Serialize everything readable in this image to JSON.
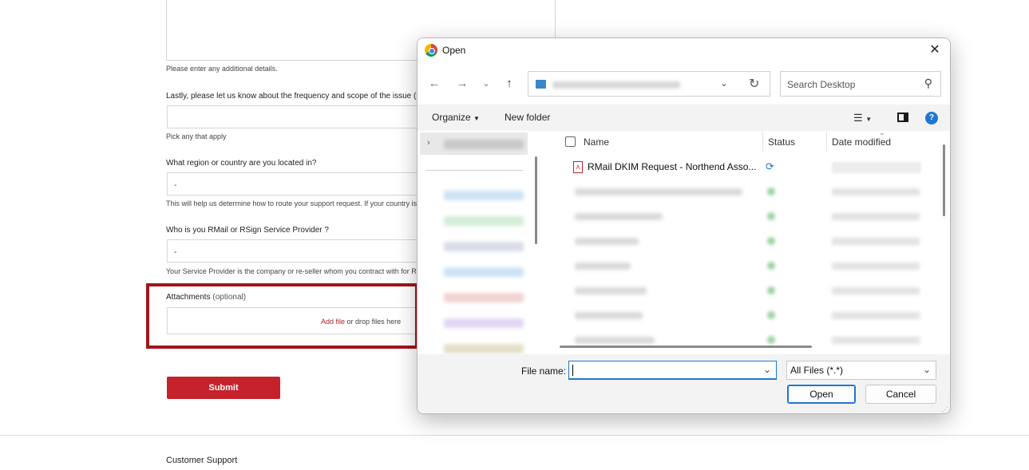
{
  "form": {
    "details_help": "Please enter any additional details.",
    "frequency_question": "Lastly, please let us know about the frequency and scope of the issue (op",
    "frequency_help": "Pick any that apply",
    "region_question": "What region or country are you located in?",
    "region_value": "-",
    "region_help": "This will help us determine how to route your support request. If your country is",
    "provider_question": "Who is you RMail or RSign Service Provider ?",
    "provider_value": "-",
    "provider_help": "Your Service Provider is the company or re-seller whom you contract with for R",
    "attachments_label": "Attachments",
    "attachments_optional": "(optional)",
    "add_file": "Add file",
    "drop_text": "or drop files here",
    "submit_label": "Submit",
    "highlight_color": "#a3141b",
    "submit_color": "#c5222b"
  },
  "footer": {
    "customer_support": "Customer Support"
  },
  "dialog": {
    "title": "Open",
    "title_icon": "chrome-icon",
    "close_icon": "close-icon",
    "search_placeholder": "Search Desktop",
    "toolbar": {
      "organize": "Organize",
      "new_folder": "New folder"
    },
    "columns": {
      "name": "Name",
      "status": "Status",
      "date_modified": "Date modified"
    },
    "files": [
      {
        "name": "RMail DKIM Request - Northend Asso...",
        "type": "pdf",
        "status_icon": "sync-icon"
      }
    ],
    "file_name_label": "File name:",
    "file_name_value": "",
    "file_type_value": "All Files (*.*)",
    "open_label": "Open",
    "cancel_label": "Cancel",
    "accent_color": "#1e78d2"
  }
}
